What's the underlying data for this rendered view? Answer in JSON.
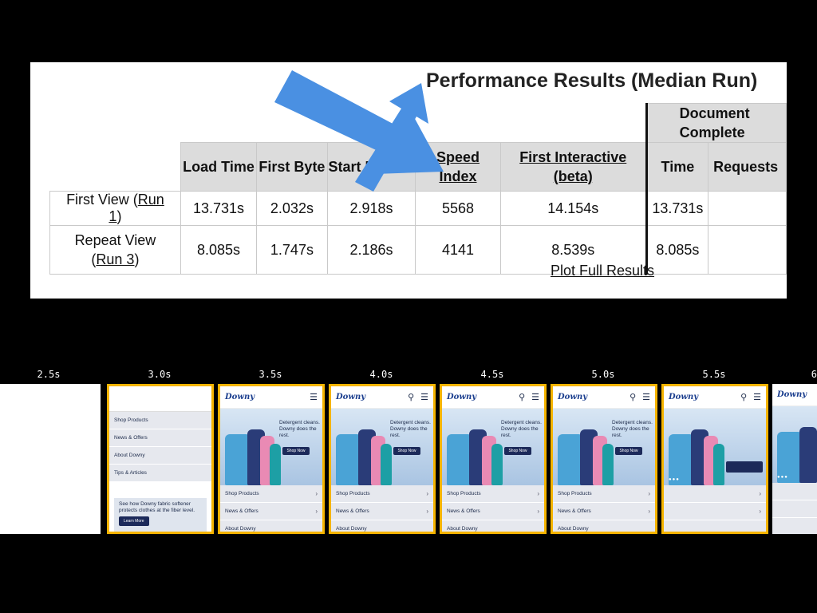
{
  "panel": {
    "title": "Performance Results (Median Run)",
    "headers": {
      "load_time": "Load Time",
      "first_byte": "First Byte",
      "start_render": "Start Render",
      "speed_index": "Speed Index",
      "first_interactive": "First Interactive (beta)",
      "doc_group": "Document Complete",
      "doc_time": "Time",
      "doc_requests": "Requests"
    },
    "rows": [
      {
        "label_prefix": "First View (",
        "run_link": "Run 1",
        "label_suffix": ")",
        "load_time": "13.731s",
        "first_byte": "2.032s",
        "start_render": "2.918s",
        "speed_index": "5568",
        "first_interactive": "14.154s",
        "doc_time": "13.731s"
      },
      {
        "label_prefix": "Repeat View (",
        "run_link": "Run 3",
        "label_suffix": ")",
        "load_time": "8.085s",
        "first_byte": "1.747s",
        "start_render": "2.186s",
        "speed_index": "4141",
        "first_interactive": "8.539s",
        "doc_time": "8.085s"
      }
    ],
    "plot_link": "Plot Full Results"
  },
  "arrows": {
    "color": "#4a90e2"
  },
  "filmstrip": {
    "timestamps": [
      "2.5s",
      "3.0s",
      "3.5s",
      "4.0s",
      "4.5s",
      "5.0s",
      "5.5s",
      "6"
    ],
    "highlight_color": "#f5b400",
    "logo": "Downy",
    "hero_text": "Detergent cleans. Downy does the rest.",
    "hero_button": "Shop Now",
    "menu_items": [
      "Shop Products",
      "News & Offers",
      "About Downy",
      "Tips & Articles"
    ],
    "promo_text": "See how Downy fabric softener protects clothes at the fiber level.",
    "promo_button": "Learn More"
  }
}
